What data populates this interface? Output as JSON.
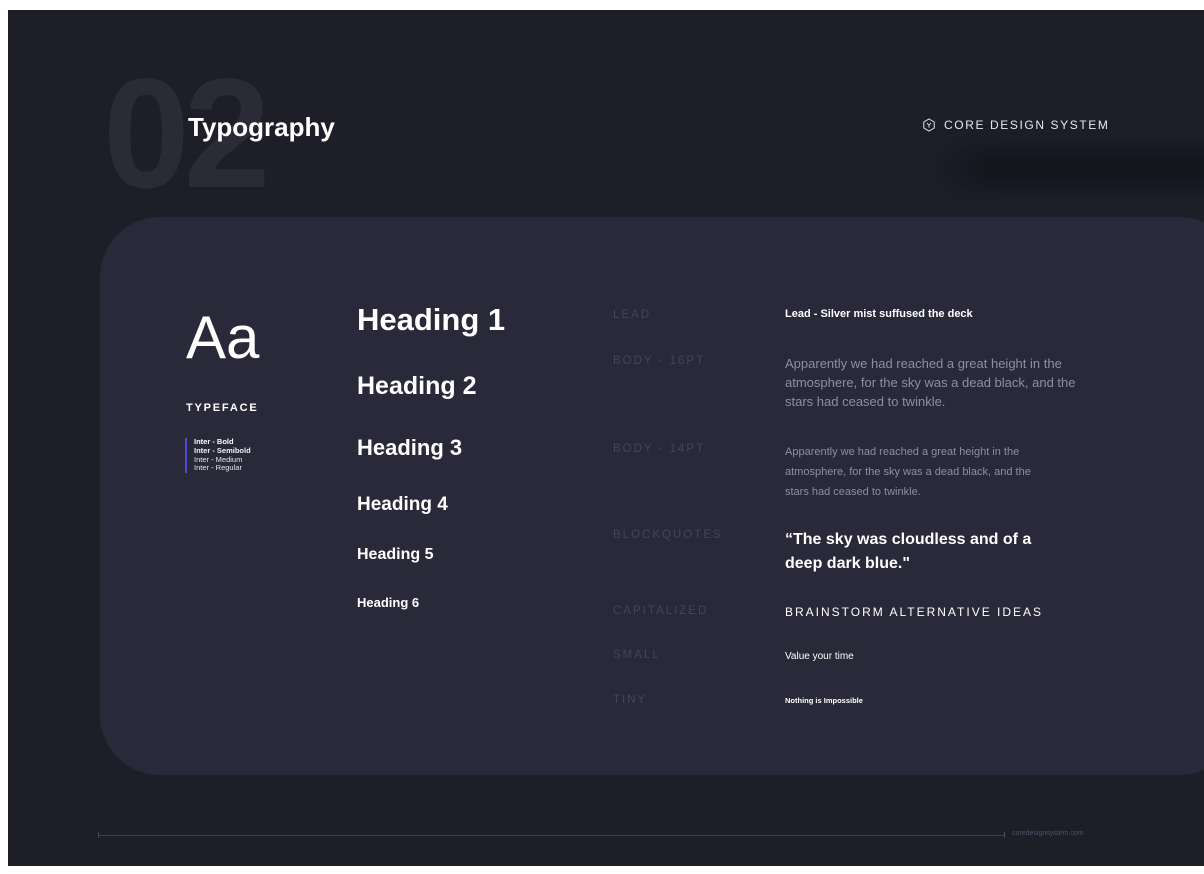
{
  "header": {
    "section_number": "02",
    "title": "Typography",
    "brand_name": "CORE DESIGN SYSTEM",
    "brand_icon": "hexagon-logo-icon"
  },
  "typeface": {
    "specimen": "Aa",
    "label": "TYPEFACE",
    "weights": [
      "Inter - Bold",
      "Inter - Semibold",
      "Inter - Medium",
      "Inter - Regular"
    ]
  },
  "headings": [
    "Heading 1",
    "Heading 2",
    "Heading 3",
    "Heading 4",
    "Heading 5",
    "Heading 6"
  ],
  "styles": [
    {
      "label": "LEAD",
      "sample": "Lead - Silver mist suffused the deck"
    },
    {
      "label": "BODY - 16PT",
      "sample": "Apparently we had reached a great height in the atmosphere, for the sky was a dead black, and the stars had ceased to twinkle."
    },
    {
      "label": "BODY - 14PT",
      "sample": "Apparently we had reached a great height in the atmosphere, for the sky was a dead black, and the stars had ceased to twinkle."
    },
    {
      "label": "BLOCKQUOTES",
      "sample": "“The sky was cloudless and of a deep dark blue.\""
    },
    {
      "label": "CAPITALIZED",
      "sample": "BRAINSTORM ALTERNATIVE IDEAS"
    },
    {
      "label": "SMALL",
      "sample": "Value your time"
    },
    {
      "label": "TINY",
      "sample": "Nothing is Impossible"
    }
  ],
  "footer": {
    "url": "coredesignsystem.com"
  },
  "colors": {
    "background": "#1e1e29",
    "card": "#292939",
    "accent": "#4b4fd0",
    "muted_label": "#44445a",
    "body_text": "#8d8ea6"
  }
}
